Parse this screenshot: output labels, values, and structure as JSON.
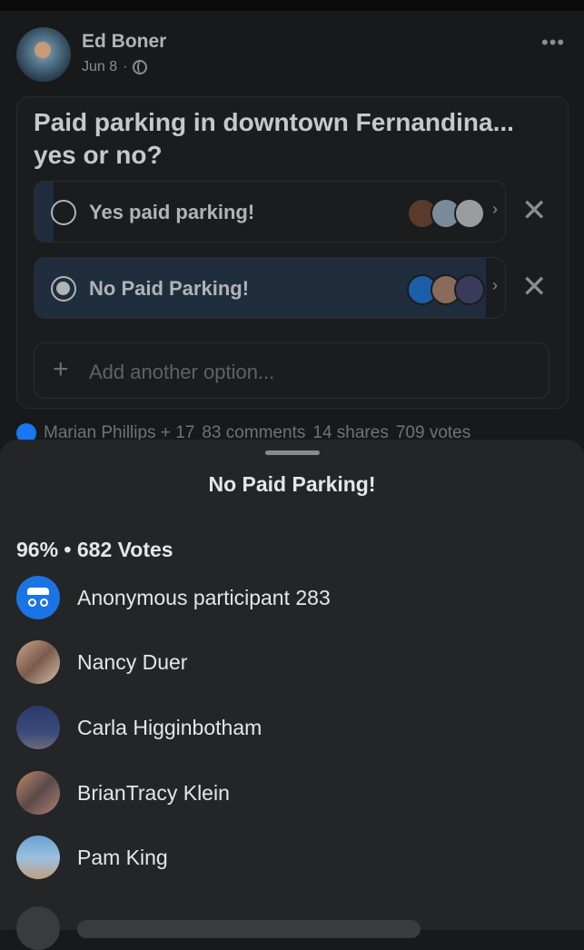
{
  "post": {
    "author": "Ed Boner",
    "date": "Jun 8",
    "separator": "·",
    "more": "•••",
    "question": "Paid parking in downtown Fernandina... yes or no?",
    "options": [
      {
        "label": "Yes paid parking!",
        "percent": 4,
        "selected": false
      },
      {
        "label": "No Paid Parking!",
        "percent": 96,
        "selected": true
      }
    ],
    "add_option": "Add another option...",
    "footer": {
      "reactors": "Marian Phillips + 17",
      "comments": "83 comments",
      "shares": "14 shares",
      "votes": "709 votes"
    }
  },
  "sheet": {
    "title": "No Paid Parking!",
    "stats": "96% • 682 Votes",
    "voters": [
      {
        "name": "Anonymous participant 283",
        "avatar": "incognito-icon"
      },
      {
        "name": "Nancy Duer",
        "avatar": "photo"
      },
      {
        "name": "Carla Higginbotham",
        "avatar": "photo"
      },
      {
        "name": "BrianTracy Klein",
        "avatar": "photo"
      },
      {
        "name": "Pam King",
        "avatar": "photo"
      }
    ]
  },
  "colors": {
    "background": "#18191a",
    "sheet": "#242526",
    "accent": "#1b74e4"
  }
}
